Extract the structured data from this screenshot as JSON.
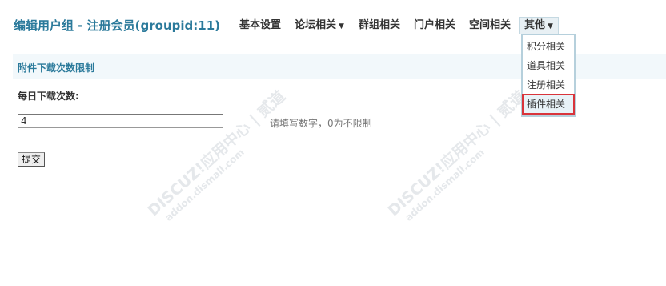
{
  "page_title": "编辑用户组 - 注册会员(groupid:11)",
  "nav": {
    "items": [
      {
        "label": "基本设置",
        "has_arrow": false
      },
      {
        "label": "论坛相关",
        "has_arrow": true
      },
      {
        "label": "群组相关",
        "has_arrow": false
      },
      {
        "label": "门户相关",
        "has_arrow": false
      },
      {
        "label": "空间相关",
        "has_arrow": false
      },
      {
        "label": "其他",
        "has_arrow": true,
        "active": true
      }
    ],
    "arrow_glyph": "▼"
  },
  "dropdown": {
    "items": [
      {
        "label": "积分相关"
      },
      {
        "label": "道具相关"
      },
      {
        "label": "注册相关"
      },
      {
        "label": "插件相关",
        "highlighted": true
      }
    ]
  },
  "section": {
    "title": "附件下载次数限制"
  },
  "form": {
    "field_label": "每日下载次数:",
    "field_value": "4",
    "hint": "请填写数字，0为不限制",
    "submit_label": "提交"
  },
  "watermark": {
    "brand": "DISCUZ!应用中心 | 贰道",
    "url": "addon.dismall.com"
  },
  "colors": {
    "title": "#2b7a9b",
    "highlight_border": "#d9343b",
    "section_bg": "#f2f8fb"
  }
}
